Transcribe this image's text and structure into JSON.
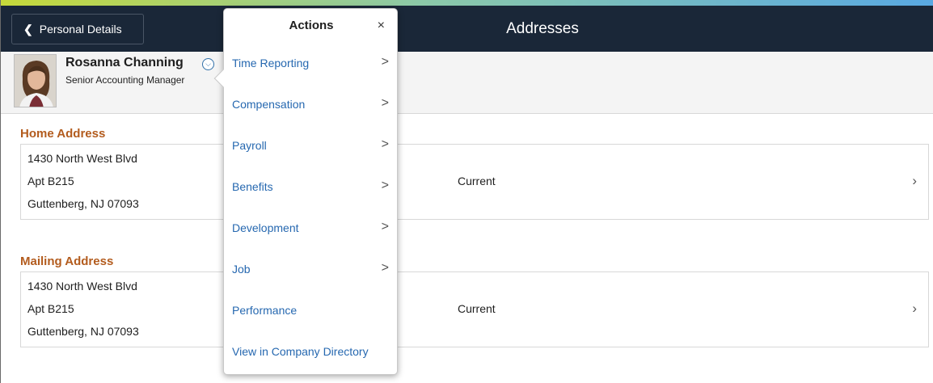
{
  "header": {
    "back_label": "Personal Details",
    "back_icon": "chevron-left-icon",
    "title": "Addresses"
  },
  "employee": {
    "name": "Rosanna Channing",
    "job_title": "Senior Accounting Manager",
    "menu_icon": "chevron-down-circle-icon"
  },
  "addresses": [
    {
      "title": "Home Address",
      "lines": [
        "1430 North West Blvd",
        "Apt B215",
        "Guttenberg, NJ 07093"
      ],
      "status": "Current"
    },
    {
      "title": "Mailing Address",
      "lines": [
        "1430 North West Blvd",
        "Apt B215",
        "Guttenberg, NJ 07093"
      ],
      "status": "Current"
    }
  ],
  "actions_menu": {
    "title": "Actions",
    "close": "×",
    "items": [
      {
        "label": "Time Reporting",
        "chevron": ">"
      },
      {
        "label": "Compensation",
        "chevron": ">"
      },
      {
        "label": "Payroll",
        "chevron": ">"
      },
      {
        "label": "Benefits",
        "chevron": ">"
      },
      {
        "label": "Development",
        "chevron": ">"
      },
      {
        "label": "Job",
        "chevron": ">"
      },
      {
        "label": "Performance",
        "chevron": ""
      },
      {
        "label": "View in Company Directory",
        "chevron": ""
      }
    ]
  },
  "colors": {
    "header_bg": "#1a2738",
    "section_title": "#b35c1e",
    "link": "#2668b0"
  }
}
